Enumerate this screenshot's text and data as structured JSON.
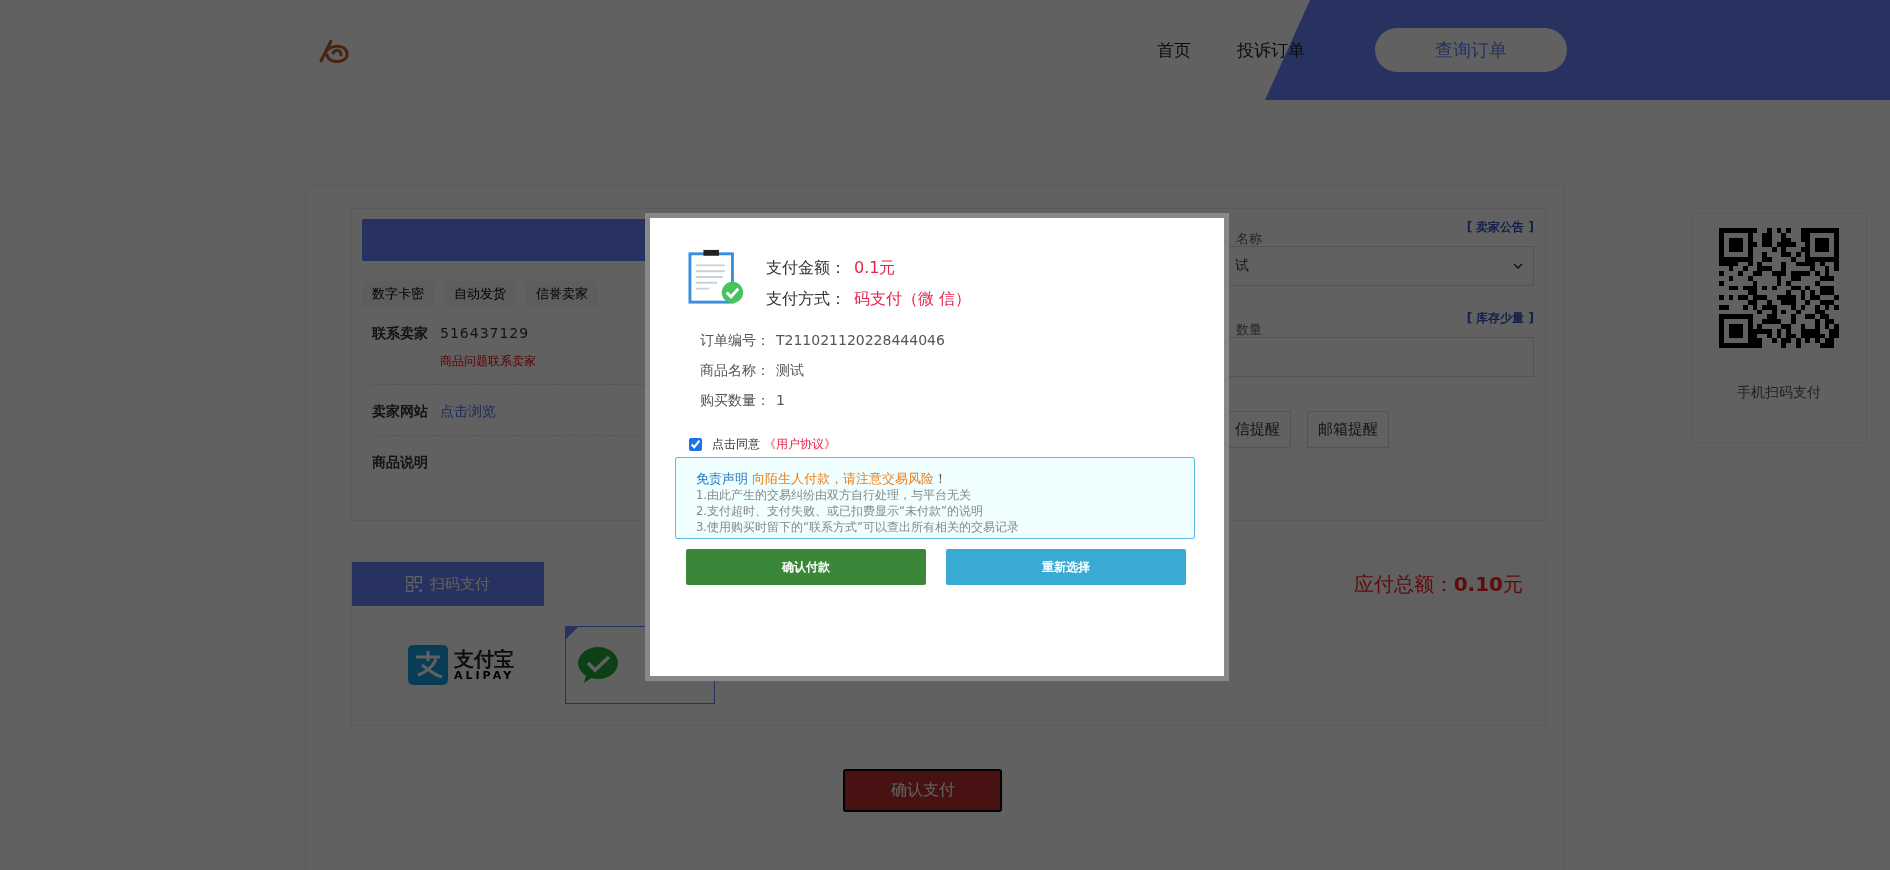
{
  "header": {
    "nav": [
      "首页",
      "投诉订单"
    ],
    "query_button": "查询订单"
  },
  "product": {
    "tags": [
      "数字卡密",
      "自动发货",
      "信誉卖家"
    ],
    "contact": {
      "label": "联系卖家",
      "value": "516437129",
      "note": "商品问题联系卖家"
    },
    "site": {
      "label": "卖家网站",
      "link": "点击浏览"
    },
    "description_label": "商品说明",
    "notice_link": "[ 卖家公告 ]",
    "name_label": "名称",
    "name_value": "试",
    "stock_link": "[ 库存少量 ]",
    "quantity_label": "数量",
    "remind_buttons": [
      "信提醒",
      "邮箱提醒"
    ]
  },
  "qr_panel": {
    "caption": "手机扫码支付"
  },
  "payment": {
    "tab": "扫码支付",
    "total_label": "应付总额：",
    "total_value": "0.10",
    "total_unit": "元",
    "methods": [
      {
        "kind": "alipay",
        "name": "支付宝",
        "subtitle": "ALIPAY",
        "selected": false
      },
      {
        "kind": "wechat",
        "selected": true
      }
    ]
  },
  "confirm_button": "确认支付",
  "modal": {
    "amount_label": "支付金额：",
    "amount_value": "0.1元",
    "method_label": "支付方式：",
    "method_value": "码支付（微 信）",
    "details": [
      {
        "label": "订单编号：",
        "value": "T211021120228444046"
      },
      {
        "label": "商品名称：",
        "value": "测试"
      },
      {
        "label": "购买数量：",
        "value": "1"
      }
    ],
    "agree": {
      "checked": true,
      "text": "点击同意",
      "link": "《用户协议》"
    },
    "disclaimer": {
      "title": "免责声明",
      "warning": "向陌生人付款，请注意交易风险",
      "mark": "！",
      "lines": [
        "1.由此产生的交易纠纷由双方自行处理，与平台无关",
        "2.支付超时、支付失败、或已扣费显示“未付款”的说明",
        "3.使用购买时留下的“联系方式”可以查出所有相关的交易记录"
      ]
    },
    "buttons": [
      {
        "kind": "confirm",
        "label": "确认付款"
      },
      {
        "kind": "reselect",
        "label": "重新选择"
      }
    ]
  }
}
